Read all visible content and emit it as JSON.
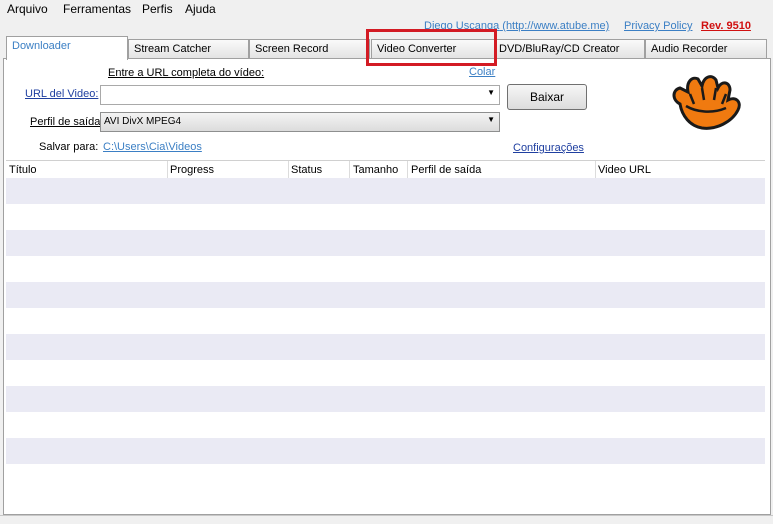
{
  "menu": [
    "Arquivo",
    "Ferramentas",
    "Perfis",
    "Ajuda"
  ],
  "header": {
    "author": "Diego Uscanga",
    "site": "(http://www.atube.me)",
    "privacy": "Privacy Policy",
    "rev": "Rev. 9510"
  },
  "tabs": [
    "Downloader",
    "Stream Catcher",
    "Screen Record",
    "Video Converter",
    "DVD/BluRay/CD Creator",
    "Audio Recorder"
  ],
  "form": {
    "hint": "Entre a URL completa do vídeo:",
    "paste": "Colar",
    "url_label": "URL del Video:",
    "url_value": "",
    "download_button": "Baixar",
    "profile_label": "Perfil de saída",
    "profile_value": "AVI DivX MPEG4",
    "save_label": "Salvar para:",
    "save_path": "C:\\Users\\Cia\\Videos",
    "settings": "Configurações"
  },
  "table": {
    "columns": [
      "Título",
      "Progress",
      "Status",
      "Tamanho",
      "Perfil de saída",
      "Video URL"
    ]
  },
  "colors": {
    "highlight": "#d31b24",
    "link": "#3b7fc4",
    "logo": "#f07a10"
  }
}
